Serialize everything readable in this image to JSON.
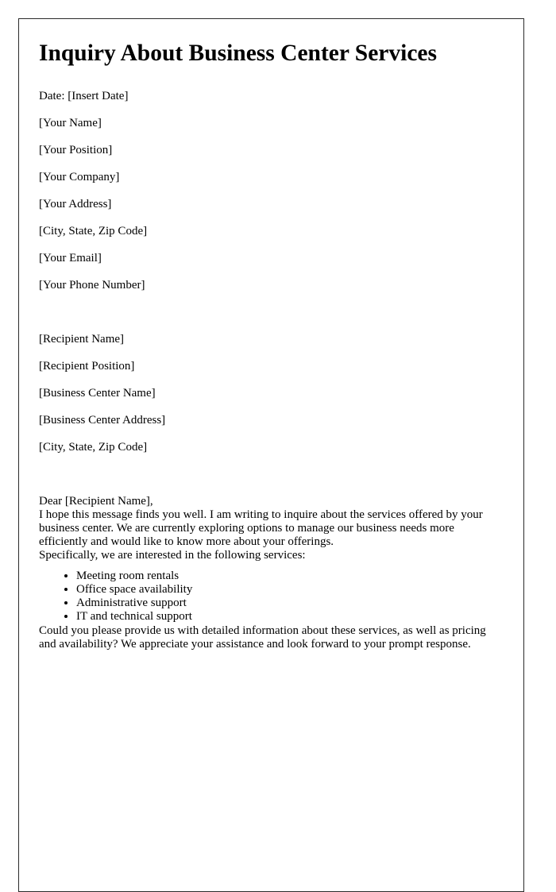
{
  "document": {
    "title": "Inquiry About Business Center Services",
    "date_line": "Date: [Insert Date]",
    "sender_block": [
      "[Your Name]",
      "[Your Position]",
      "[Your Company]",
      "[Your Address]",
      "[City, State, Zip Code]",
      "[Your Email]",
      "[Your Phone Number]"
    ],
    "recipient_block": [
      "[Recipient Name]",
      "[Recipient Position]",
      "[Business Center Name]",
      "[Business Center Address]",
      "[City, State, Zip Code]"
    ],
    "salutation": "Dear [Recipient Name],",
    "paragraph_1": "I hope this message finds you well. I am writing to inquire about the services offered by your business center. We are currently exploring options to manage our business needs more efficiently and would like to know more about your offerings.",
    "services_intro": "Specifically, we are interested in the following services:",
    "services": [
      "Meeting room rentals",
      "Office space availability",
      "Administrative support",
      "IT and technical support"
    ],
    "paragraph_2": "Could you please provide us with detailed information about these services, as well as pricing and availability? We appreciate your assistance and look forward to your prompt response.",
    "colors": {
      "text": "#000000",
      "page_background": "#ffffff",
      "page_border": "#2b2b2b"
    }
  }
}
